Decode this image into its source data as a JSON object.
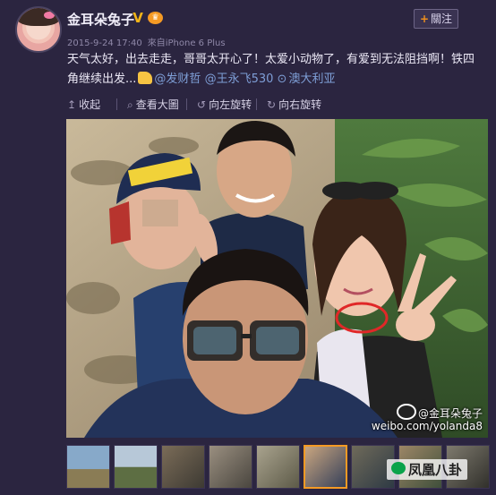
{
  "user": {
    "name": "金耳朵兔子",
    "verified_mark": "V",
    "vip_mark": "♛"
  },
  "follow_button": {
    "plus": "+",
    "label": "關注"
  },
  "meta": {
    "timestamp": "2015-9-24 17:40",
    "source": "來自iPhone 6 Plus"
  },
  "post": {
    "text_line1": "天气太好，出去走走，哥哥太开心了！太爱小动物了，有爱到无法阻挡啊！铁四",
    "text_line2": "角继续出发...",
    "mention1": "@发财哲",
    "mention2": "@王永飞530",
    "location": "澳大利亚"
  },
  "toolbar": {
    "collapse": "收起",
    "view_large": "查看大圖",
    "rotate_left": "向左旋转",
    "rotate_right": "向右旋转"
  },
  "photo": {
    "watermark_handle": "@金耳朵兔子",
    "watermark_url": "weibo.com/yolanda8"
  },
  "thumbnails": {
    "count": 9,
    "active_index": 5
  },
  "brand": {
    "label": "凤凰八卦"
  },
  "colors": {
    "background": "#2b2540",
    "link": "#7e9ed6",
    "accent": "#f59a24"
  }
}
